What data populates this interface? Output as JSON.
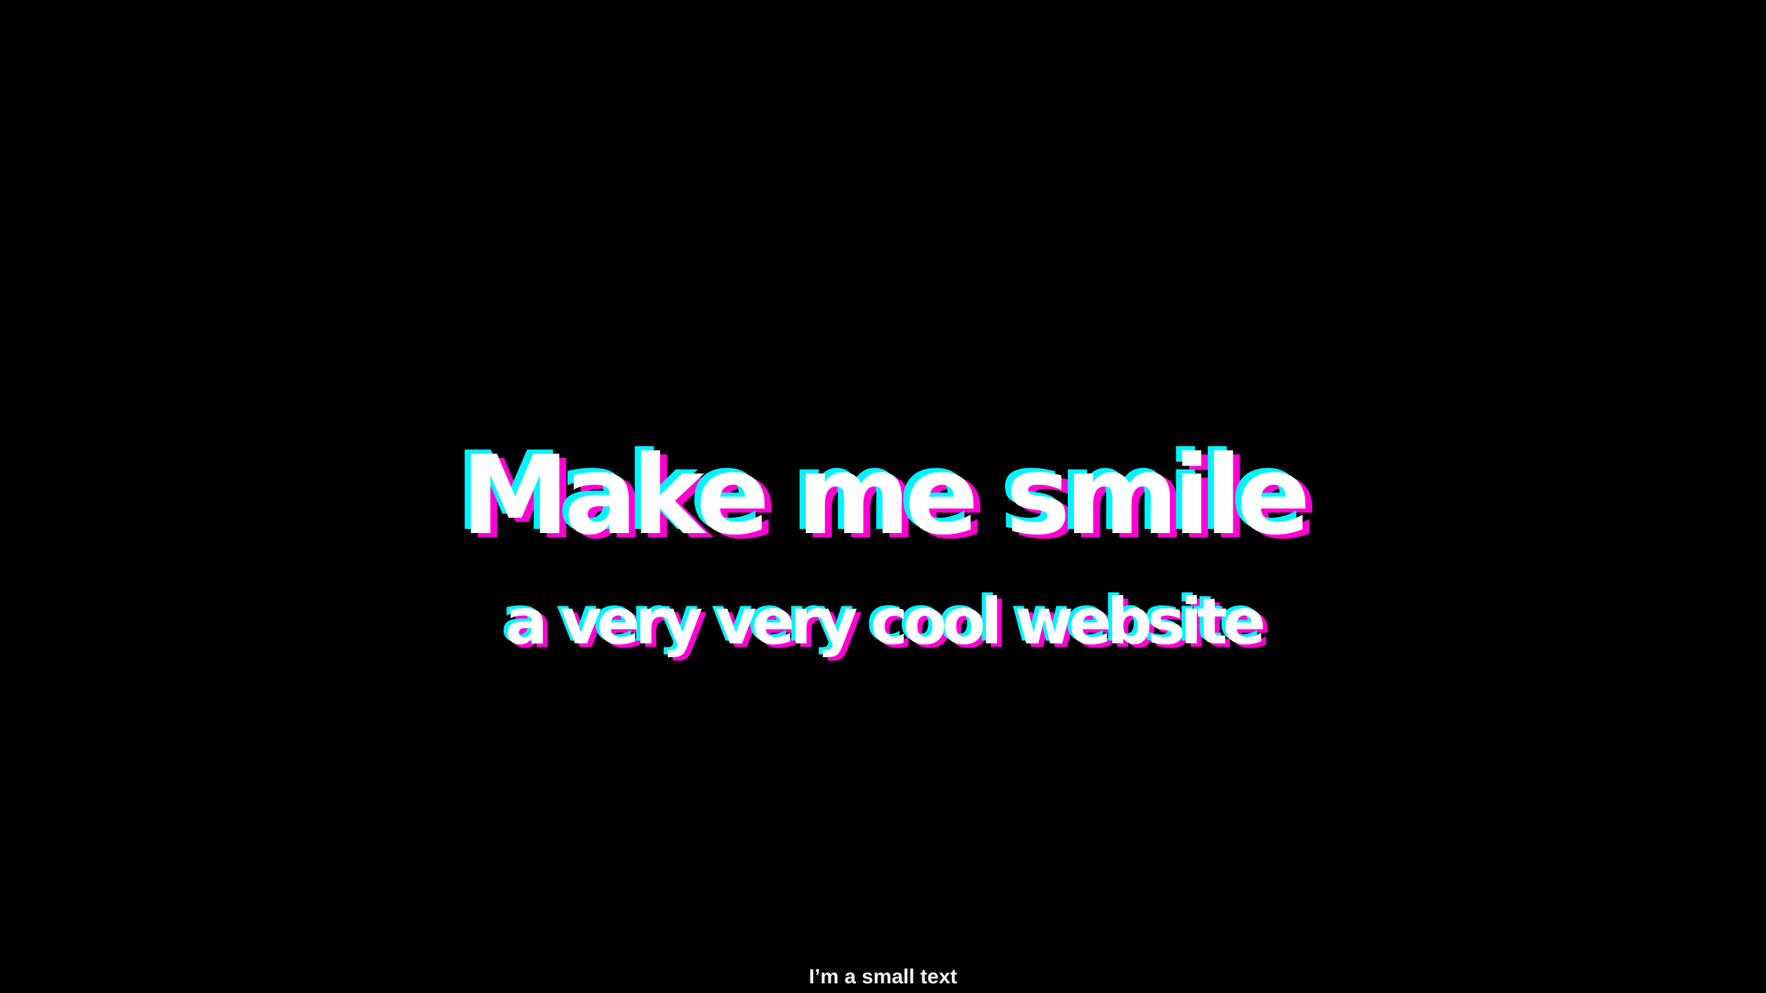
{
  "hero": {
    "title": "Make me smile",
    "subtitle": "a very very cool website"
  },
  "footer": {
    "small_text": "I’m a small text"
  },
  "colors": {
    "background": "#000000",
    "text": "#ffffff",
    "cyan_glitch": "#00f4ff",
    "magenta_glitch": "#ff00d4"
  }
}
